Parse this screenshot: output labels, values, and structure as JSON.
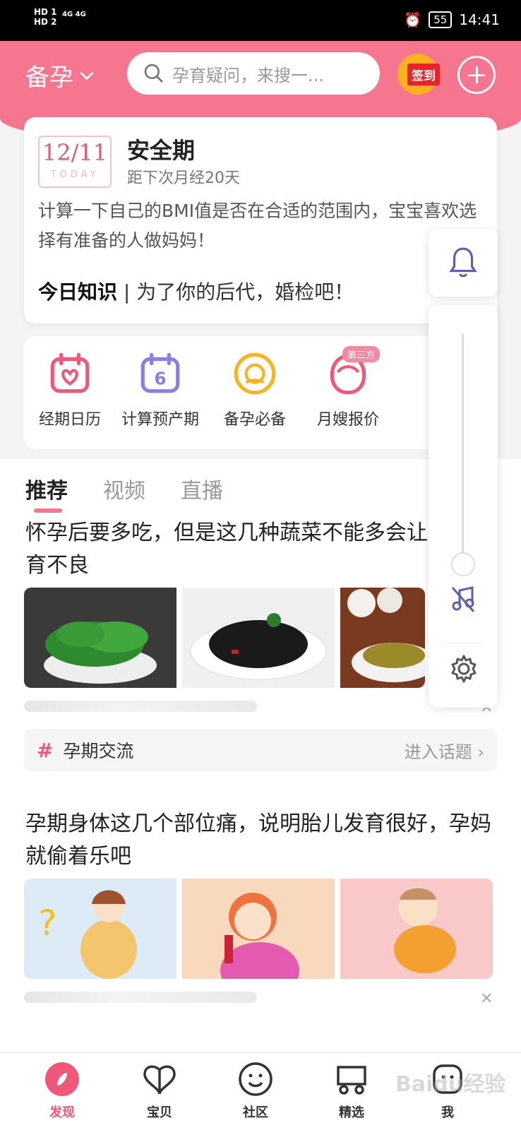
{
  "status_bar": {
    "sim_left": "HD 1\nHD 2",
    "network": "4G 4G",
    "battery": "55",
    "time": "14:41"
  },
  "header": {
    "mode_label": "备孕",
    "search_placeholder": "孕育疑问，来搜一...",
    "checkin_label": "签到"
  },
  "cycle_card": {
    "date": "12/11",
    "today": "TODAY",
    "status": "安全期",
    "countdown": "距下次月经20天",
    "tip": "计算一下自己的BMI值是否在合适的范围内，宝宝喜欢选择有准备的人做妈妈！",
    "knowledge_label": "今日知识",
    "knowledge_text": "为了你的后代，婚检吧！"
  },
  "tools": [
    {
      "label": "经期日历"
    },
    {
      "label": "计算预产期"
    },
    {
      "label": "备孕必备"
    },
    {
      "label": "月嫂报价",
      "badge": "第三方"
    }
  ],
  "tabs": [
    "推荐",
    "视频",
    "直播"
  ],
  "feed": {
    "article1_title": "怀孕后要多吃，但是这几种蔬菜不能多会让胎儿发育不良",
    "topic_label": "孕期交流",
    "topic_enter": "进入话题",
    "article2_title": "孕期身体这几个部位痛，说明胎儿发育很好，孕妈就偷着乐吧"
  },
  "bottom_nav": [
    "发现",
    "宝贝",
    "社区",
    "精选",
    "我"
  ],
  "watermark": "Baidu经验",
  "colors": {
    "brand_pink": "#f6768f",
    "accent_pink": "#f0587a",
    "tool_purple": "#8b7ee6",
    "tool_orange": "#f8b41c"
  }
}
